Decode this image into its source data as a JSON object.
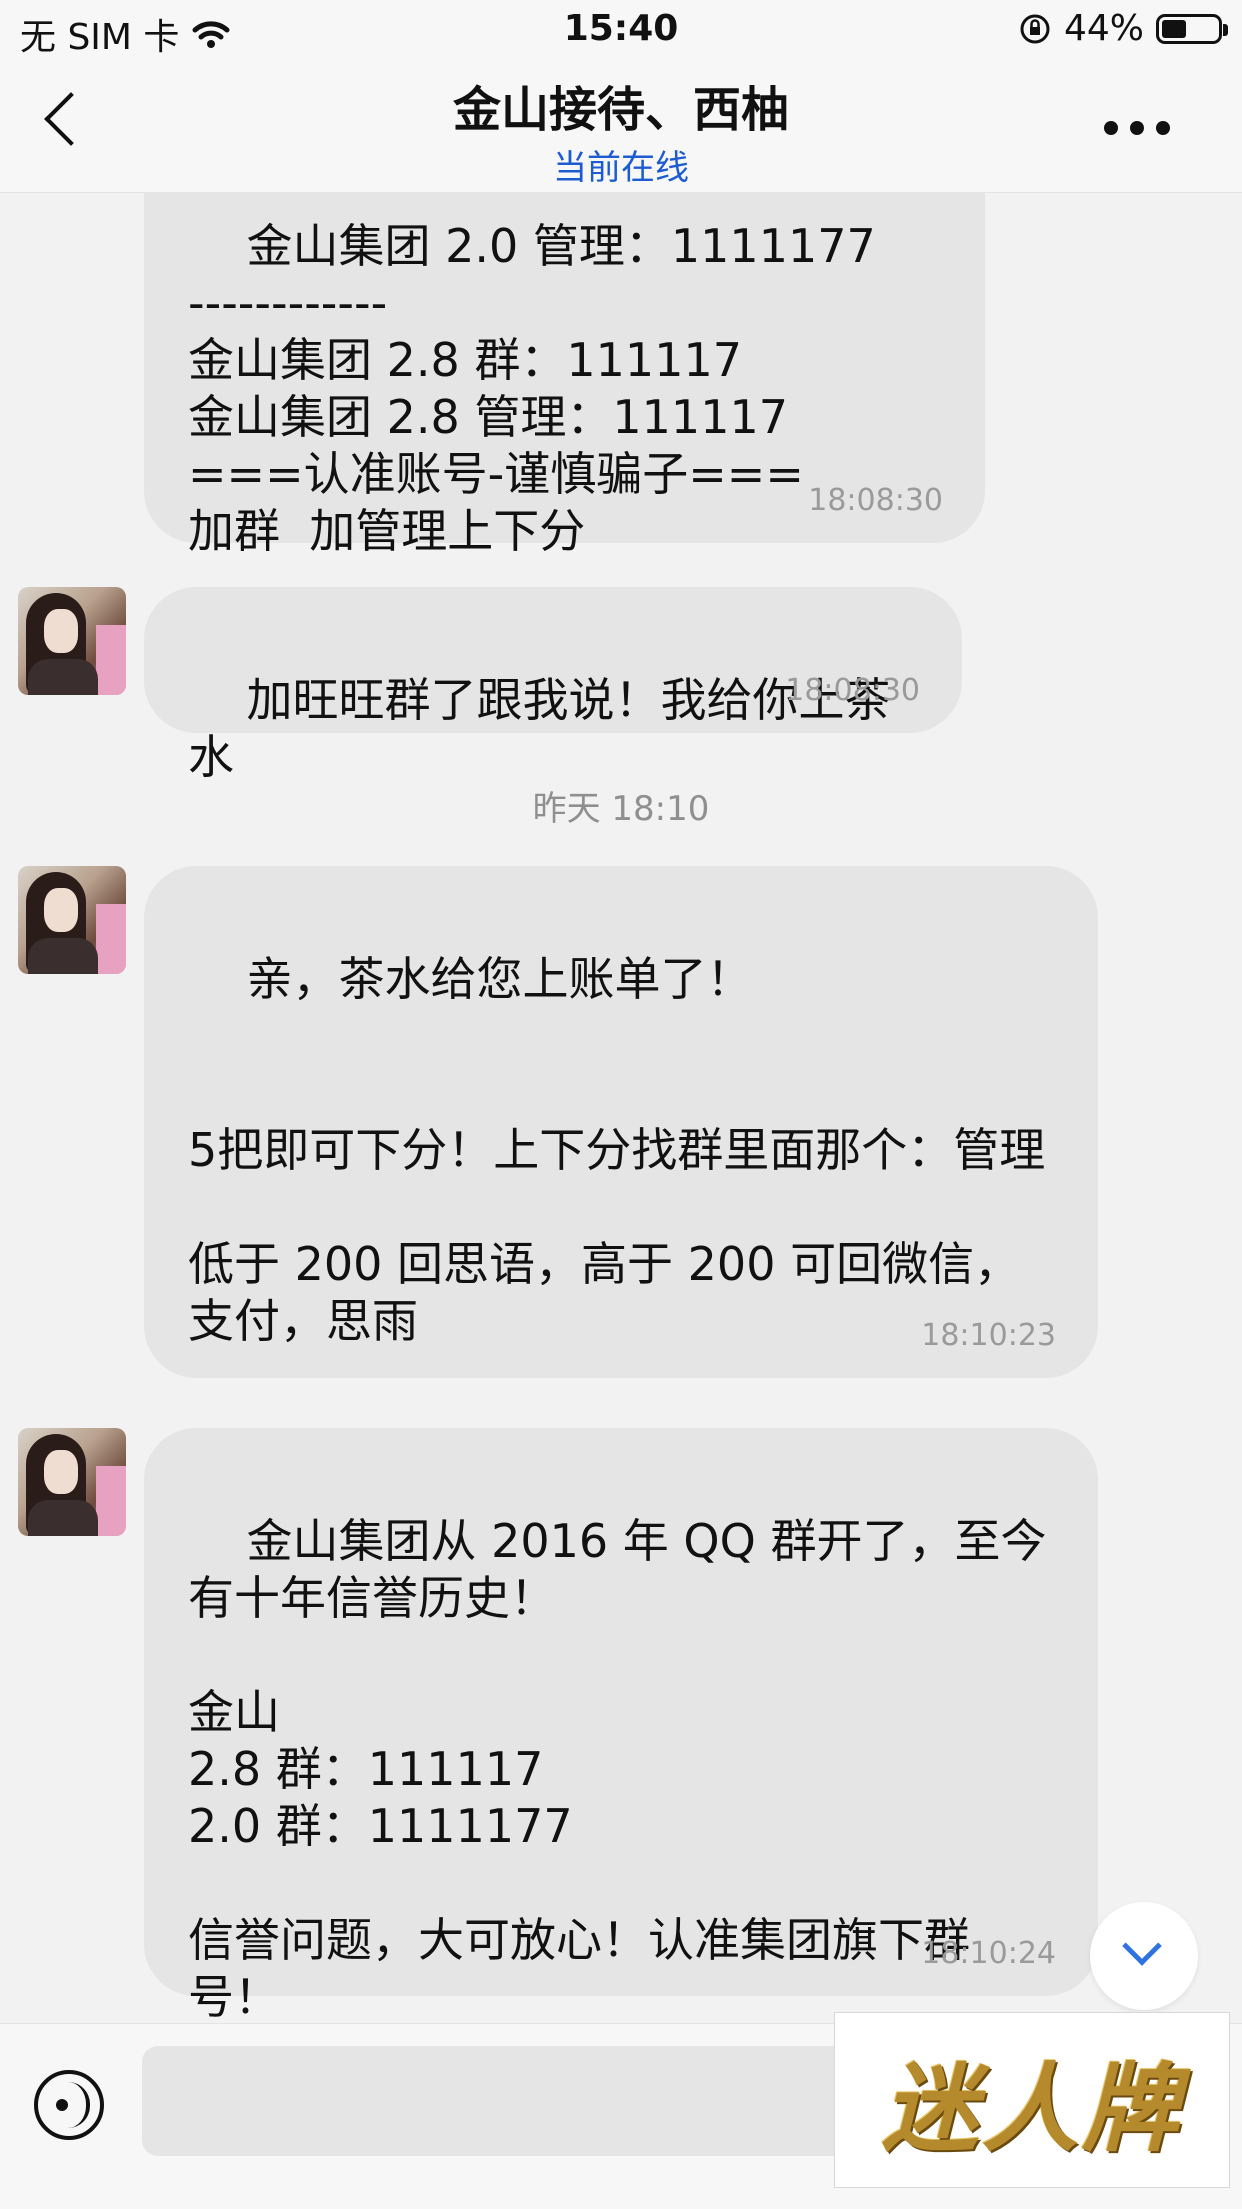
{
  "status_bar": {
    "carrier": "无 SIM 卡",
    "time": "15:40",
    "battery": "44%",
    "battery_level": 0.44
  },
  "nav": {
    "title": "金山接待、西柚",
    "subtitle": "当前在线"
  },
  "messages": [
    {
      "text": "金山集团 2.0 管理：1111177\n------------\n金山集团 2.8 群：111117\n金山集团 2.8 管理：111117\n===认准账号-谨慎骗子===\n加群  加管理上下分",
      "time": "18:08:30"
    },
    {
      "text": "加旺旺群了跟我说！我给你上茶水",
      "time": "18:08:30"
    },
    {
      "text": "亲，茶水给您上账单了！\n\n\n5把即可下分！上下分找群里面那个：管理\n\n低于 200 回思语，高于 200 可回微信，支付，思雨",
      "time": "18:10:23"
    },
    {
      "text": "金山集团从 2016 年 QQ 群开了，至今有十年信誉历史！\n\n金山\n2.8 群：111117\n2.0 群：1111177\n\n信誉问题，大可放心！认准集团旗下群号！",
      "time": "18:10:24"
    }
  ],
  "date_separator": "昨天 18:10",
  "watermark": "迷人牌"
}
